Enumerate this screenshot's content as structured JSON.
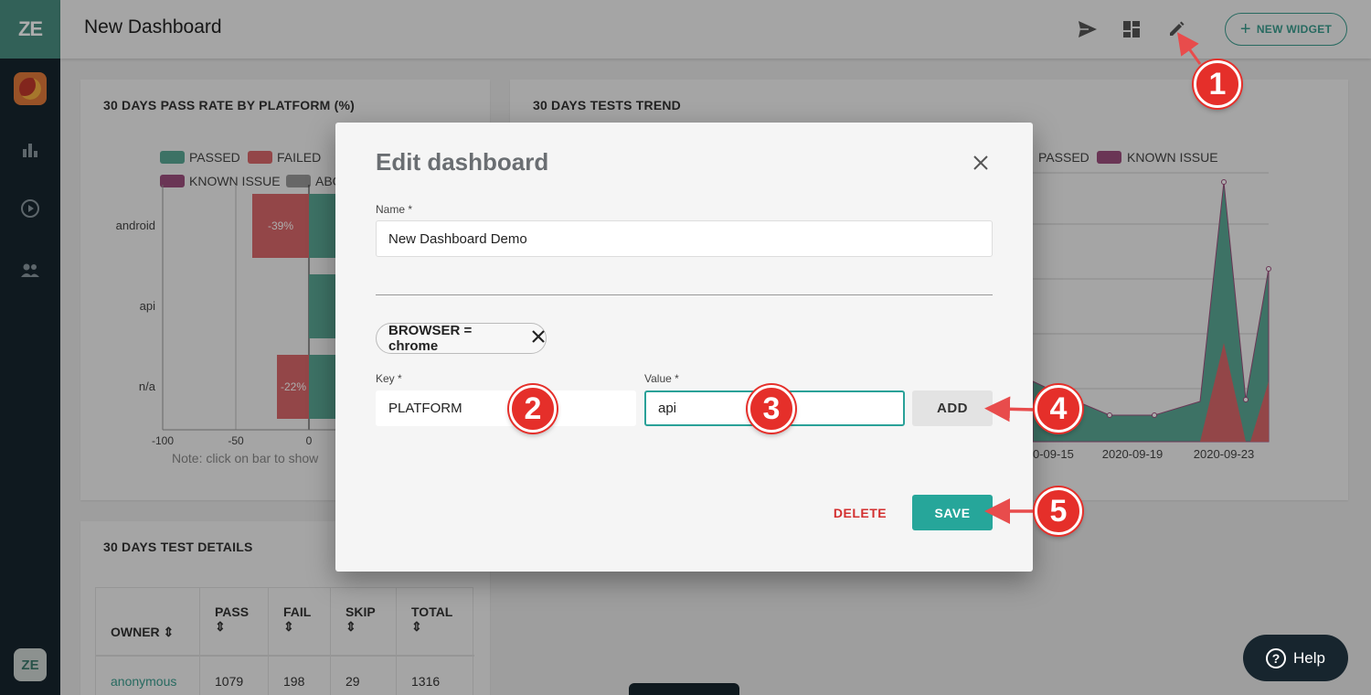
{
  "app": {
    "logo_text": "ZE",
    "bottom_logo_text": "ZE"
  },
  "header": {
    "title": "New Dashboard",
    "new_widget_label": "NEW WIDGET"
  },
  "cards": {
    "pass_rate": {
      "title": "30 DAYS PASS RATE BY PLATFORM (%)",
      "legend": [
        "PASSED",
        "FAILED",
        "KNOWN ISSUE",
        "ABO"
      ],
      "categories": [
        "android",
        "api",
        "n/a"
      ],
      "bar_labels": [
        "-39%",
        "",
        "-22%"
      ],
      "x_ticks": [
        "-100",
        "-50",
        "0"
      ],
      "note": "Note: click on bar to show"
    },
    "trend": {
      "title": "30 DAYS TESTS TREND",
      "legend": [
        "PASSED",
        "KNOWN ISSUE"
      ],
      "x_ticks": [
        "0-09-15",
        "2020-09-19",
        "2020-09-23"
      ]
    },
    "details": {
      "title": "30 DAYS TEST DETAILS",
      "columns": [
        "OWNER",
        "PASS",
        "FAIL",
        "SKIP",
        "TOTAL"
      ],
      "rows": [
        {
          "owner": "anonymous",
          "pass": "1079",
          "fail": "198",
          "skip": "29",
          "total": "1316"
        }
      ]
    }
  },
  "modal": {
    "title": "Edit dashboard",
    "name_label": "Name *",
    "name_value": "New Dashboard Demo",
    "chip_label": "BROWSER = chrome",
    "key_label": "Key *",
    "key_value": "PLATFORM",
    "value_label": "Value *",
    "value_value": "api",
    "add_label": "ADD",
    "delete_label": "DELETE",
    "save_label": "SAVE"
  },
  "callouts": [
    "1",
    "2",
    "3",
    "4",
    "5"
  ],
  "help": {
    "label": "Help"
  },
  "colors": {
    "accent": "#26a69a",
    "passed": "#5aa895",
    "failed": "#d9686a",
    "known_issue": "#9c4f7e",
    "delete": "#d32f2f",
    "badge": "#e52f2a",
    "sidebar": "#17252e"
  }
}
